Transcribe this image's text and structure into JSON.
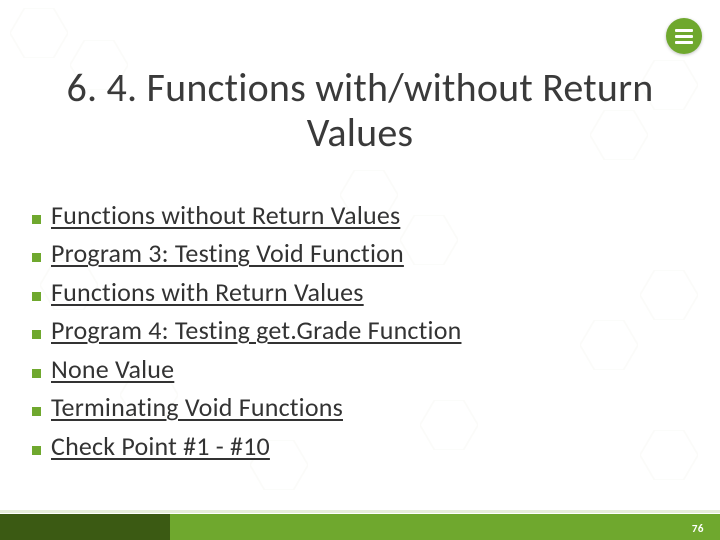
{
  "title": "6. 4. Functions with/without Return Values",
  "bullets": [
    "Functions without Return Values",
    "Program 3: Testing Void Function",
    "Functions with Return Values",
    "Program 4: Testing get.Grade Function",
    "None Value",
    "Terminating Void Functions",
    "Check Point #1 - #10"
  ],
  "page_number": "76",
  "colors": {
    "accent": "#6fa82e",
    "accent_dark": "#3b5a13"
  }
}
